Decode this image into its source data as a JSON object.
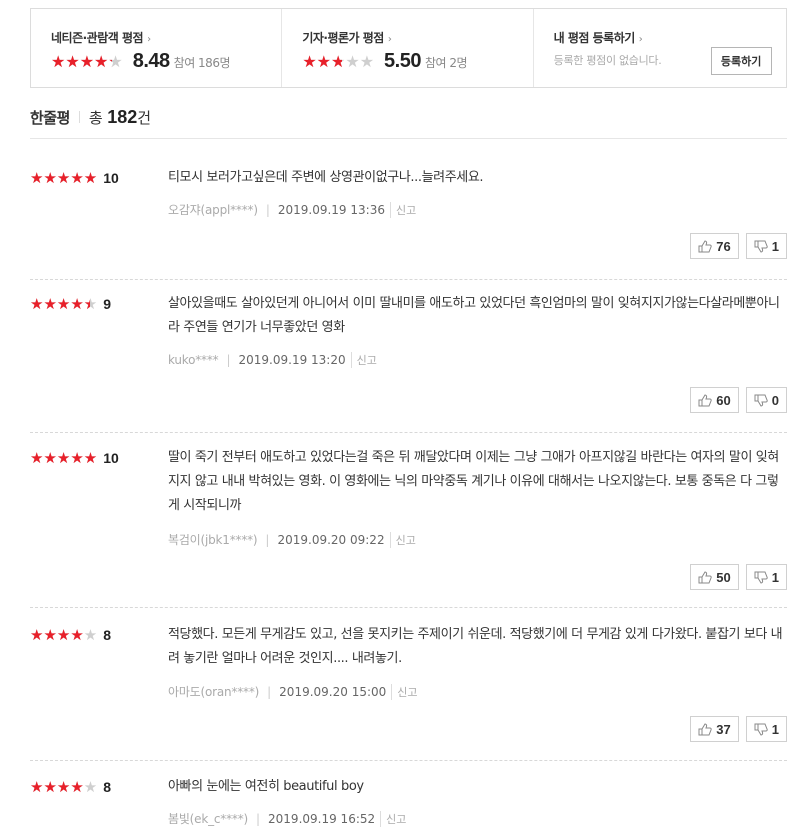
{
  "scores": [
    {
      "title": "네티즌·관람객 평점",
      "rating": 8.48,
      "score": "8.48",
      "participants": "참여 186명"
    },
    {
      "title": "기자·평론가 평점",
      "rating": 5.5,
      "score": "5.50",
      "participants": "참여 2명"
    }
  ],
  "my_rating": {
    "title": "내 평점 등록하기",
    "desc": "등록한 평점이 없습니다.",
    "button": "등록하기"
  },
  "header": {
    "title": "한줄평",
    "total_label": "총",
    "count": "182",
    "unit": "건"
  },
  "reviews": [
    {
      "rating": 10,
      "score": "10",
      "text": "티모시 보러가고싶은데 주변에 상영관이없구나...늘려주세요.",
      "author": "오감쟈(appl****)",
      "date": "2019.09.19 13:36",
      "report": "신고",
      "likes": "76",
      "dislikes": "1"
    },
    {
      "rating": 9,
      "score": "9",
      "text": "살아있을때도 살아있던게 아니어서 이미 딸내미를 애도하고 있었다던 흑인엄마의 말이 잊혀지지가않는다살라메뿐아니라 주연들 연기가 너무좋았던 영화",
      "author": "kuko****",
      "date": "2019.09.19 13:20",
      "report": "신고",
      "likes": "60",
      "dislikes": "0"
    },
    {
      "rating": 10,
      "score": "10",
      "text": "딸이 죽기 전부터 애도하고 있었다는걸 죽은 뒤 깨달았다며 이제는 그냥 그애가 아프지않길 바란다는 여자의 말이 잊혀지지 않고 내내 박혀있는 영화. 이 영화에는 닉의 마약중독 계기나 이유에 대해서는 나오지않는다. 보통 중독은 다 그렇게 시작되니까",
      "author": "복검이(jbk1****)",
      "date": "2019.09.20 09:22",
      "report": "신고",
      "likes": "50",
      "dislikes": "1"
    },
    {
      "rating": 8,
      "score": "8",
      "text": "적당했다. 모든게 무게감도 있고, 선을 못지키는 주제이기 쉬운데. 적당했기에 더 무게감 있게 다가왔다. 붙잡기 보다 내려 놓기란 얼마나 어려운 것인지.... 내려놓기.",
      "author": "아마도(oran****)",
      "date": "2019.09.20 15:00",
      "report": "신고",
      "likes": "37",
      "dislikes": "1"
    },
    {
      "rating": 8,
      "score": "8",
      "text": "아빠의 눈에는 여전히 beautiful boy",
      "author": "봄빛(ek_c****)",
      "date": "2019.09.19 16:52",
      "report": "신고",
      "likes": "",
      "dislikes": ""
    }
  ],
  "colors": {
    "star_on": "#e8202a",
    "star_off": "#cfcfcf"
  },
  "icons": {
    "star": "star-icon",
    "like": "thumbs-up-icon",
    "dislike": "thumbs-down-icon",
    "arrow": "chevron-right-icon"
  }
}
